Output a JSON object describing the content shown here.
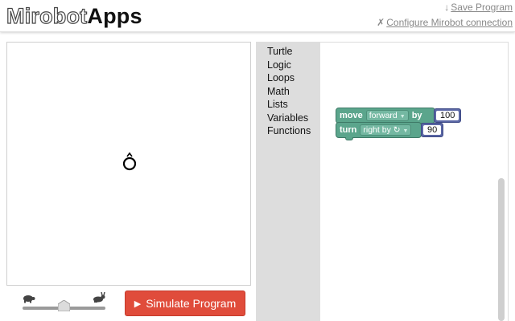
{
  "brand": {
    "part1": "Mirobot",
    "part2": "Apps"
  },
  "header": {
    "save_icon": "download-arrow-icon",
    "save_glyph": "↓",
    "save_label": "Save Program",
    "config_icon": "cross-icon",
    "config_glyph": "✗",
    "config_label": "Configure Mirobot connection"
  },
  "controls": {
    "slow_icon": "turtle-icon",
    "fast_icon": "rabbit-icon",
    "speed_level": 0.5,
    "simulate_label": "Simulate Program",
    "simulate_icon": "play-icon"
  },
  "toolbox": {
    "items": [
      "Turtle",
      "Logic",
      "Loops",
      "Math",
      "Lists",
      "Variables",
      "Functions"
    ]
  },
  "blocks": [
    {
      "keyword": "move",
      "option": "forward",
      "connector": "by",
      "value": "100"
    },
    {
      "keyword": "turn",
      "option": "right by ↻",
      "value": "90"
    }
  ],
  "colors": {
    "accent_button": "#e04c3b",
    "block_green": "#5ba58c",
    "block_blue": "#5b67a5",
    "toolbox_bg": "#dddddd"
  }
}
